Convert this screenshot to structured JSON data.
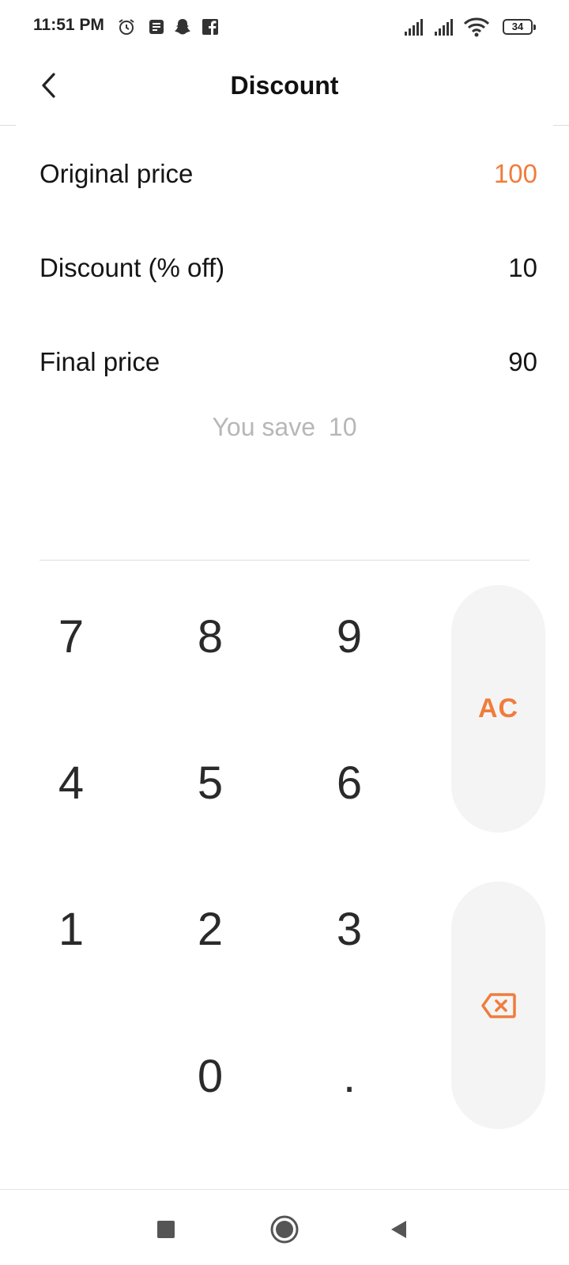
{
  "status_bar": {
    "time": "11:51 PM",
    "battery": "34",
    "icons": [
      "alarm-icon",
      "notes-icon",
      "snapchat-icon",
      "facebook-icon",
      "signal-icon",
      "signal-icon",
      "wifi-icon",
      "battery-icon"
    ]
  },
  "header": {
    "title": "Discount",
    "back_icon": "chevron-left-icon"
  },
  "fields": {
    "original_price": {
      "label": "Original price",
      "value": "100",
      "active": true
    },
    "discount": {
      "label": "Discount (% off)",
      "value": "10"
    },
    "final_price": {
      "label": "Final price",
      "value": "90"
    }
  },
  "savings": {
    "label": "You save",
    "value": "10"
  },
  "keypad": {
    "keys": [
      "7",
      "8",
      "9",
      "4",
      "5",
      "6",
      "1",
      "2",
      "3",
      "0",
      "."
    ],
    "clear_label": "AC",
    "backspace_icon": "backspace-icon"
  },
  "nav_bar": {
    "icons": [
      "recents-square-icon",
      "home-circle-icon",
      "back-triangle-icon"
    ]
  },
  "colors": {
    "accent": "#f07c3c",
    "muted_text": "#b7b7b7",
    "key_background": "#f4f4f4"
  }
}
